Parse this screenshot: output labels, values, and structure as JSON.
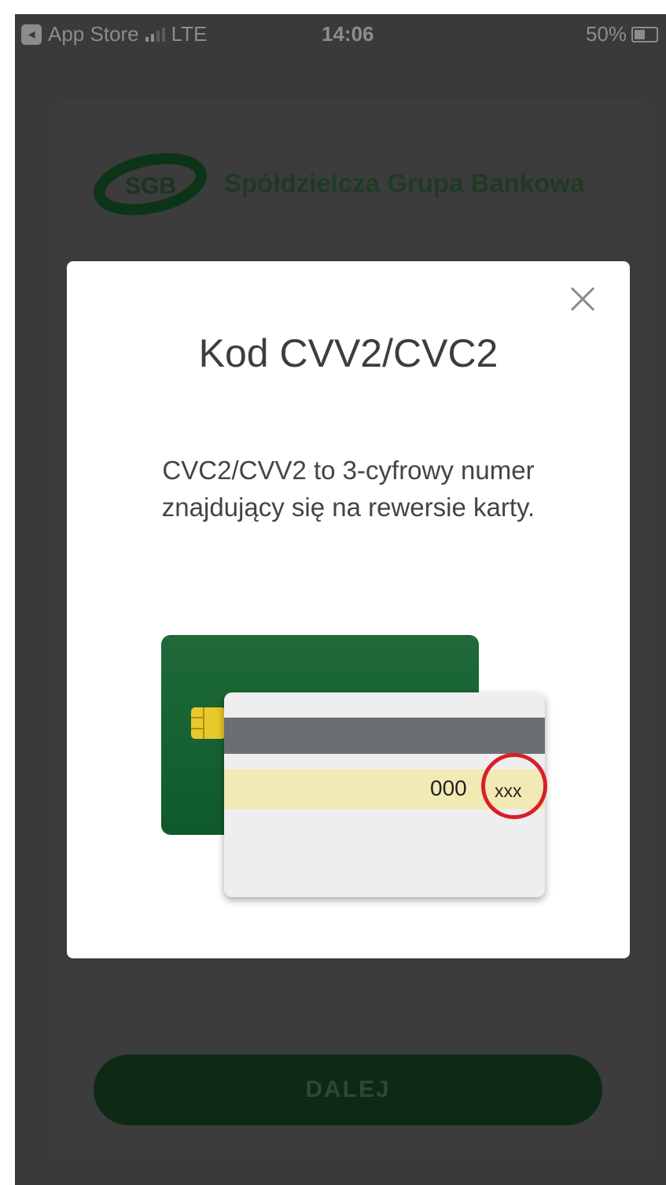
{
  "status_bar": {
    "back_app": "App Store",
    "network": "LTE",
    "time": "14:06",
    "battery": "50%"
  },
  "logo": {
    "mark_text": "SGB",
    "name": "Spółdzielcza Grupa Bankowa"
  },
  "modal": {
    "title": "Kod CVV2/CVC2",
    "description": "CVC2/CVV2 to 3-cyfrowy numer znajdujący się na rewersie karty.",
    "card_number_tail": "000",
    "cvv_placeholder": "xxx"
  },
  "button": {
    "next_label": "DALEJ"
  },
  "colors": {
    "overlay": "#3a3a3a",
    "brand_green": "#0f5a2c",
    "highlight_red": "#d81f2a",
    "chip_gold": "#e9c92c"
  },
  "icons": [
    "app-store-icon",
    "signal-icon",
    "battery-icon",
    "close-icon",
    "chip-icon"
  ]
}
